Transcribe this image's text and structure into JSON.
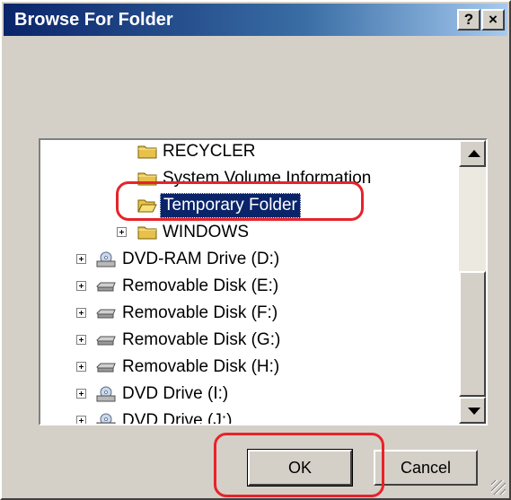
{
  "window": {
    "title": "Browse For Folder",
    "help_label": "?",
    "close_label": "×"
  },
  "tree": {
    "items": [
      {
        "label": "RECYCLER",
        "icon": "folder-icon",
        "expandable": false,
        "selected": false
      },
      {
        "label": "System Volume Information",
        "icon": "folder-icon",
        "expandable": false,
        "selected": false
      },
      {
        "label": "Temporary Folder",
        "icon": "folder-open-icon",
        "expandable": false,
        "selected": true
      },
      {
        "label": "WINDOWS",
        "icon": "folder-icon",
        "expandable": true,
        "selected": false
      },
      {
        "label": "DVD-RAM Drive (D:)",
        "icon": "dvd-drive-icon",
        "expandable": true,
        "selected": false
      },
      {
        "label": "Removable Disk (E:)",
        "icon": "removable-disk-icon",
        "expandable": true,
        "selected": false
      },
      {
        "label": "Removable Disk (F:)",
        "icon": "removable-disk-icon",
        "expandable": true,
        "selected": false
      },
      {
        "label": "Removable Disk (G:)",
        "icon": "removable-disk-icon",
        "expandable": true,
        "selected": false
      },
      {
        "label": "Removable Disk (H:)",
        "icon": "removable-disk-icon",
        "expandable": true,
        "selected": false
      },
      {
        "label": "DVD Drive (I:)",
        "icon": "dvd-drive-icon",
        "expandable": true,
        "selected": false
      },
      {
        "label": "DVD Drive (J:)",
        "icon": "dvd-drive-icon",
        "expandable": true,
        "selected": false
      }
    ]
  },
  "buttons": {
    "ok_label": "OK",
    "cancel_label": "Cancel"
  },
  "colors": {
    "titlebar": "#0a246a",
    "selection": "#0a246a",
    "annotation": "#e8222a",
    "face": "#d4d0c8"
  }
}
